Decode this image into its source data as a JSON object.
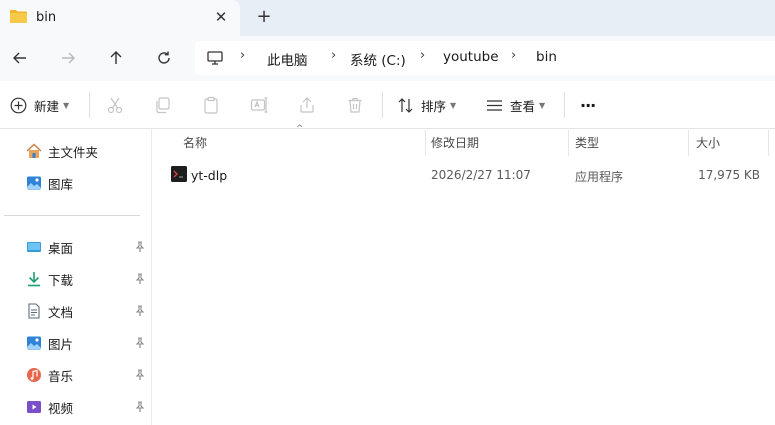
{
  "tab": {
    "title": "bin",
    "close": "✕",
    "new": "+"
  },
  "breadcrumb": {
    "items": [
      "此电脑",
      "系统 (C:)",
      "youtube",
      "bin"
    ],
    "separator": "›"
  },
  "toolbar": {
    "new_label": "新建",
    "sort_label": "排序",
    "view_label": "查看",
    "more": "···"
  },
  "sidebar": {
    "top": [
      {
        "label": "主文件夹",
        "icon": "home-icon"
      },
      {
        "label": "图库",
        "icon": "gallery-icon"
      }
    ],
    "pinned": [
      {
        "label": "桌面",
        "icon": "desktop-icon"
      },
      {
        "label": "下载",
        "icon": "download-icon"
      },
      {
        "label": "文档",
        "icon": "document-icon"
      },
      {
        "label": "图片",
        "icon": "pictures-icon"
      },
      {
        "label": "音乐",
        "icon": "music-icon"
      },
      {
        "label": "视频",
        "icon": "video-icon"
      }
    ]
  },
  "columns": {
    "name": "名称",
    "modified": "修改日期",
    "type": "类型",
    "size": "大小"
  },
  "files": [
    {
      "name": "yt-dlp",
      "modified": "2026/2/27 11:07",
      "type": "应用程序",
      "size": "17,975 KB",
      "icon": "terminal-app-icon"
    }
  ],
  "colors": {
    "accent": "#0067c0",
    "tabstrip": "#e8eef5",
    "chrome": "#f7f9fb",
    "folder": "#f7c948"
  }
}
